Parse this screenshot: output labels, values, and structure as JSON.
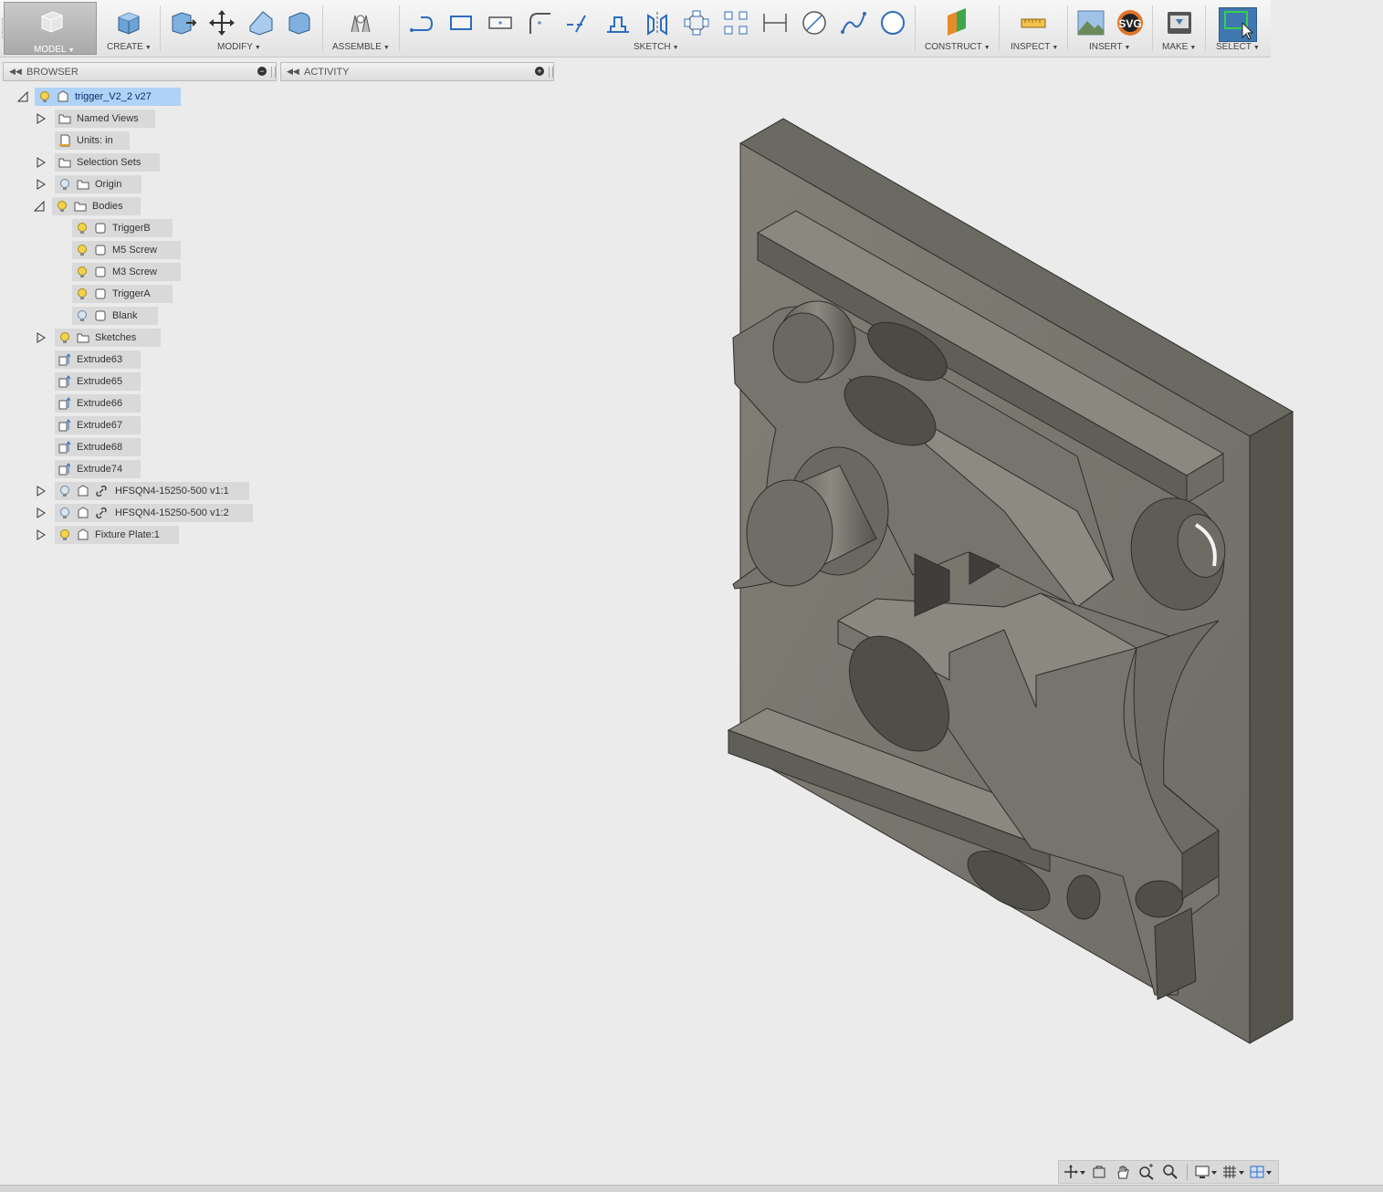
{
  "toolbar": {
    "model": "MODEL",
    "create": "CREATE",
    "modify": "MODIFY",
    "assemble": "ASSEMBLE",
    "sketch": "SKETCH",
    "construct": "CONSTRUCT",
    "inspect": "INSPECT",
    "insert": "INSERT",
    "make": "MAKE",
    "select": "SELECT",
    "svg_text": "SVG"
  },
  "browser": {
    "title": "BROWSER",
    "root": "trigger_V2_2 v27",
    "named_views": "Named Views",
    "units": "Units: in",
    "selection_sets": "Selection Sets",
    "origin": "Origin",
    "bodies": "Bodies",
    "body_items": [
      "TriggerB",
      "M5 Screw",
      "M3 Screw",
      "TriggerA",
      "Blank"
    ],
    "sketches": "Sketches",
    "features": [
      "Extrude63",
      "Extrude65",
      "Extrude66",
      "Extrude67",
      "Extrude68",
      "Extrude74"
    ],
    "components": [
      "HFSQN4-15250-500 v1:1",
      "HFSQN4-15250-500 v1:2",
      "Fixture Plate:1"
    ]
  },
  "activity": {
    "title": "ACTIVITY"
  },
  "colors": {
    "accent": "#3f78b0",
    "selection": "#aed3f6",
    "node_bg": "#d9d9d9",
    "model_face": "#7b7a72",
    "model_side": "#56554e",
    "bulb_on": "#f3d34a"
  }
}
